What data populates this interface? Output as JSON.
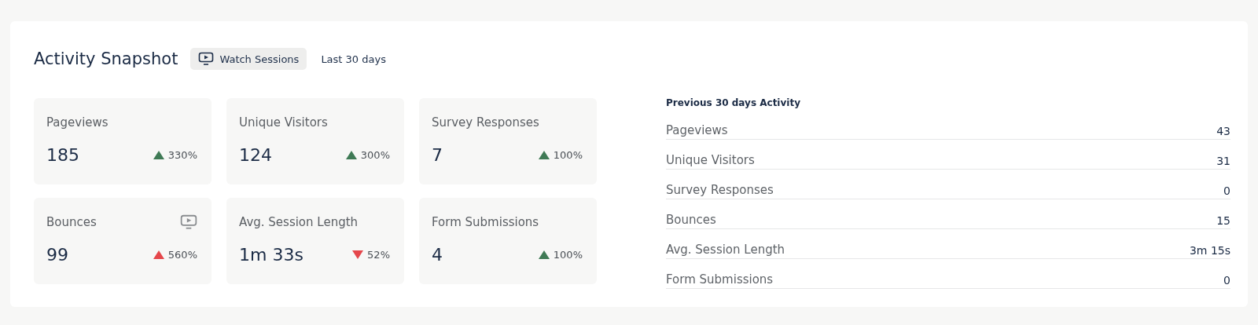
{
  "header": {
    "title": "Activity Snapshot",
    "watch_button": "Watch Sessions",
    "period": "Last 30 days"
  },
  "metrics": [
    {
      "label": "Pageviews",
      "value": "185",
      "kind": "up",
      "color": "#3f7a55",
      "change": "330%",
      "session_icon": false
    },
    {
      "label": "Unique Visitors",
      "value": "124",
      "kind": "up",
      "color": "#3f7a55",
      "change": "300%",
      "session_icon": false
    },
    {
      "label": "Survey Responses",
      "value": "7",
      "kind": "up",
      "color": "#3f7a55",
      "change": "100%",
      "session_icon": false
    },
    {
      "label": "Bounces",
      "value": "99",
      "kind": "up",
      "color": "#e5474b",
      "change": "560%",
      "session_icon": true
    },
    {
      "label": "Avg. Session Length",
      "value": "1m 33s",
      "kind": "down",
      "color": "#e5474b",
      "change": "52%",
      "session_icon": false
    },
    {
      "label": "Form Submissions",
      "value": "4",
      "kind": "up",
      "color": "#3f7a55",
      "change": "100%",
      "session_icon": false
    }
  ],
  "previous": {
    "title": "Previous 30 days Activity",
    "rows": [
      {
        "label": "Pageviews",
        "value": "43"
      },
      {
        "label": "Unique Visitors",
        "value": "31"
      },
      {
        "label": "Survey Responses",
        "value": "0"
      },
      {
        "label": "Bounces",
        "value": "15"
      },
      {
        "label": "Avg. Session Length",
        "value": "3m 15s"
      },
      {
        "label": "Form Submissions",
        "value": "0"
      }
    ]
  }
}
